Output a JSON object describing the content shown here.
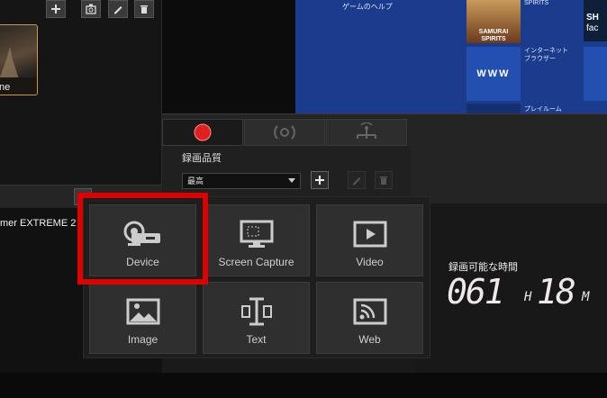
{
  "left_panel": {
    "thumbnail_label": "ne",
    "device_name": "mer EXTREME 2"
  },
  "ps_screen": {
    "top_text": "ゲームのヘルプ",
    "tile1_top": "SPIRITS",
    "tile1_title": "SAMURAI SPIRITS",
    "tile2_label": "インターネット\nブラウザー",
    "tile2_icon": "WWW",
    "tile3_label": "プレイルーム",
    "tile4_title": "SH",
    "tile4_sub": "fac"
  },
  "recording": {
    "quality_label": "録画品質",
    "quality_value": "最高"
  },
  "time_remaining": {
    "label": "録画可能な時間",
    "hours": "061",
    "h_unit": "H",
    "minutes": "18",
    "m_unit": "M"
  },
  "sources": [
    {
      "label": "Device",
      "icon": "device-icon"
    },
    {
      "label": "Screen Capture",
      "icon": "monitor-icon"
    },
    {
      "label": "Video",
      "icon": "video-play-icon"
    },
    {
      "label": "Image",
      "icon": "image-icon"
    },
    {
      "label": "Text",
      "icon": "text-cursor-icon"
    },
    {
      "label": "Web",
      "icon": "cast-icon"
    }
  ],
  "colors": {
    "highlight": "#e00000",
    "record": "#e02020",
    "digits": "#f0e8e8",
    "ps_blue": "#1b3c8c"
  }
}
